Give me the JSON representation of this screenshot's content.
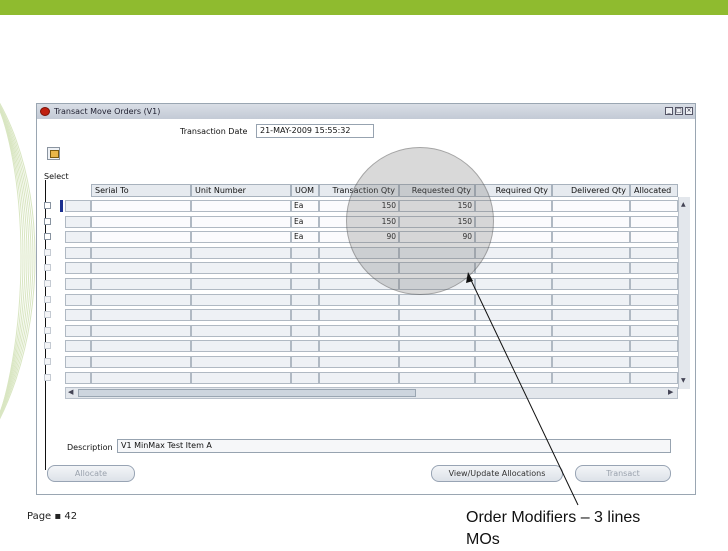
{
  "window": {
    "title": "Transact Move Orders (V1)"
  },
  "header": {
    "transaction_date_label": "Transaction Date",
    "transaction_date_value": "21-MAY-2009 15:55:32"
  },
  "select_label": "Select",
  "table": {
    "columns": [
      "Serial To",
      "Unit Number",
      "UOM",
      "Transaction Qty",
      "Requested Qty",
      "Required Qty",
      "Delivered Qty",
      "Allocated"
    ],
    "rows": [
      {
        "uom": "Ea",
        "transaction_qty": "150",
        "requested_qty": "150"
      },
      {
        "uom": "Ea",
        "transaction_qty": "150",
        "requested_qty": "150"
      },
      {
        "uom": "Ea",
        "transaction_qty": "90",
        "requested_qty": "90"
      }
    ],
    "empty_rows": 9
  },
  "description": {
    "label": "Description",
    "value": "V1 MinMax Test Item A"
  },
  "buttons": {
    "allocate": "Allocate",
    "view_update": "View/Update Allocations",
    "transact": "Transact"
  },
  "footer": {
    "page_label": "Page ▪ 42"
  },
  "callout": {
    "line1": "Order Modifiers – 3 lines",
    "line2": "MOs"
  },
  "colors": {
    "top_bar": "#8fbb2f",
    "title_icon": "#c02010"
  }
}
